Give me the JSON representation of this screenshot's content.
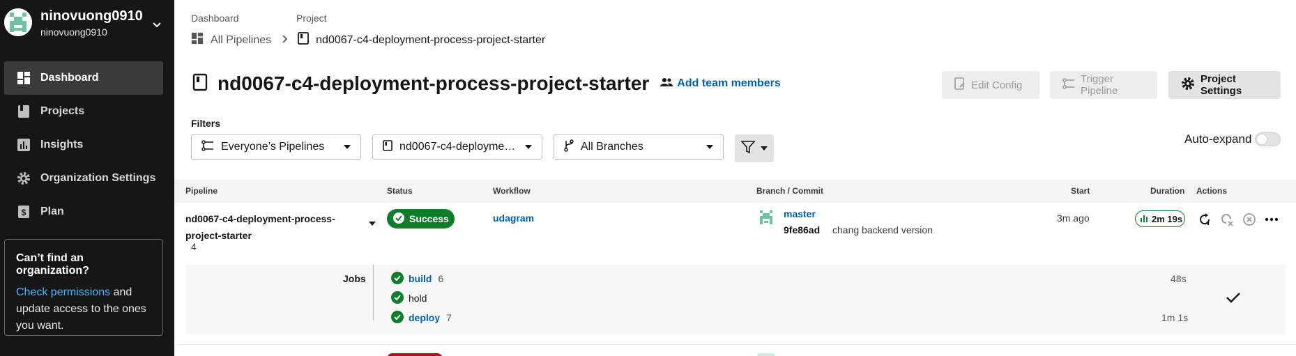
{
  "sidebar": {
    "org_name": "ninovuong0910",
    "org_sub": "ninovuong0910",
    "items": [
      {
        "label": "Dashboard",
        "icon": "dashboard-icon",
        "active": true
      },
      {
        "label": "Projects",
        "icon": "projects-icon",
        "active": false
      },
      {
        "label": "Insights",
        "icon": "insights-icon",
        "active": false
      },
      {
        "label": "Organization Settings",
        "icon": "gear-icon",
        "active": false
      },
      {
        "label": "Plan",
        "icon": "plan-icon",
        "active": false
      }
    ],
    "help": {
      "title": "Can’t find an organization?",
      "link": "Check permissions",
      "text": " and update access to the ones you want."
    }
  },
  "breadcrumb": {
    "dashboard_label": "Dashboard",
    "project_label": "Project",
    "dashboard_value": "All Pipelines",
    "project_value": "nd0067-c4-deployment-process-project-starter"
  },
  "header": {
    "title": "nd0067-c4-deployment-process-project-starter",
    "add_team": "Add team members",
    "edit_config": "Edit Config",
    "trigger_pipeline": "Trigger Pipeline",
    "project_settings": "Project Settings"
  },
  "filters": {
    "label": "Filters",
    "pipelines": "Everyone’s Pipelines",
    "project": "nd0067-c4-deploymen…",
    "branches": "All Branches",
    "auto_expand": "Auto-expand"
  },
  "table": {
    "columns": [
      "Pipeline",
      "Status",
      "Workflow",
      "Branch / Commit",
      "Start",
      "Duration",
      "Actions"
    ]
  },
  "row": {
    "pipeline_name": "nd0067-c4-deployment-process-project-starter",
    "pipeline_number": "4",
    "status": "Success",
    "workflow": "udagram",
    "branch": "master",
    "commit_sha": "9fe86ad",
    "commit_message": "chang backend version",
    "start": "3m ago",
    "duration": "2m 19s",
    "jobs_label": "Jobs",
    "jobs": [
      {
        "name": "build",
        "number": "6",
        "duration": "48s",
        "link": true
      },
      {
        "name": "hold",
        "number": "",
        "duration": "",
        "link": false
      },
      {
        "name": "deploy",
        "number": "7",
        "duration": "1m 1s",
        "link": true
      }
    ]
  },
  "colors": {
    "success": "#0d7d2b",
    "link": "#0062b0",
    "sidebar": "#161616",
    "failed": "#b0111a"
  }
}
